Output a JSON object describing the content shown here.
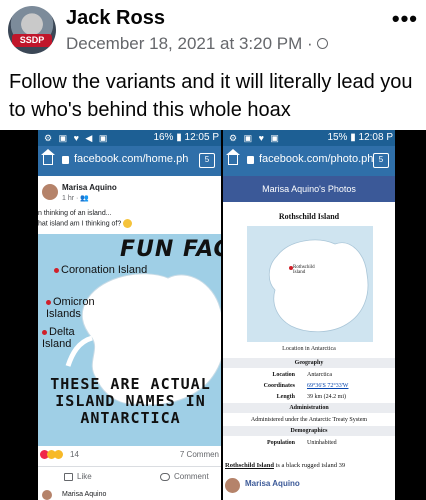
{
  "post": {
    "author": "Jack Ross",
    "timestamp": "December 18, 2021 at 3:20 PM ·",
    "avatar_badge": "SSDP",
    "caption": "Follow the variants and it will literally lead you to who's behind this whole hoax"
  },
  "left_phone": {
    "status_time": "12:05 P",
    "battery": "16%",
    "url": "facebook.com/home.ph",
    "tab_count": "5",
    "poster_name": "Marisa Aquino",
    "poster_meta": "1 hr · ",
    "post_text_line1": "n thinking of an island...",
    "post_text_line2": "hat island am I thinking of? ",
    "image_heading": "FUN FACT",
    "islands": [
      "Coronation Island",
      "Omicron Islands",
      "Delta Island"
    ],
    "image_caption": "THESE ARE ACTUAL\nISLAND NAMES IN\nANTARCTICA",
    "reaction_count": "14",
    "comment_count": "7 Commen",
    "like_label": "Like",
    "comment_label": "Comment",
    "next_commenter": "Marisa Aquino"
  },
  "right_phone": {
    "status_time": "12:08 P",
    "battery": "15%",
    "url": "facebook.com/photo.ph",
    "tab_count": "5",
    "page_title": "Marisa Aquino's Photos",
    "wiki_title": "Rothschild Island",
    "map_label": "Rothschild Island",
    "map_caption": "Location in Antarctica",
    "sections": {
      "geography": "Geography",
      "administration": "Administration",
      "demographics": "Demographics"
    },
    "rows": {
      "location_key": "Location",
      "location_val": "Antarctica",
      "coords_key": "Coordinates",
      "coords_val": "69°36'S 72°33'W",
      "length_key": "Length",
      "length_val": "39 km (24.2 mi)",
      "admin_text": "Administered under the Antarctic Treaty System",
      "population_key": "Population",
      "population_val": "Uninhabited"
    },
    "footer_bold": "Rothschild Island",
    "footer_rest": " is a black rugged island 39",
    "commenter": "Marisa Aquino"
  },
  "colors": {
    "fb_blue": "#3b5998",
    "status_blue": "#1d5f94",
    "ice_blue": "#9fcfe6"
  }
}
